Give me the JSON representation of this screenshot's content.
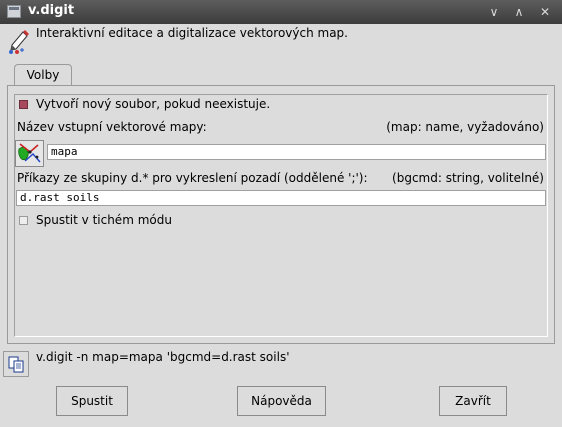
{
  "window": {
    "title": "v.digit"
  },
  "header": {
    "description": "Interaktivní editace a digitalizace vektorových map."
  },
  "tabs": [
    {
      "label": "Volby"
    }
  ],
  "options": {
    "create_new": {
      "label": "Vytvoří nový soubor, pokud neexistuje.",
      "checked": true
    },
    "map": {
      "label": "Název vstupní vektorové mapy:",
      "hint": "(map:  name, vyžadováno)",
      "value": "mapa"
    },
    "bgcmd": {
      "label": "Příkazy ze skupiny d.* pro vykreslení pozadí (oddělené ';'):",
      "hint": "(bgcmd:  string, volitelné)",
      "value": "d.rast soils"
    },
    "quiet": {
      "label": "Spustit v tichém módu",
      "checked": false
    }
  },
  "command_line": "v.digit -n map=mapa 'bgcmd=d.rast soils'",
  "buttons": {
    "run": "Spustit",
    "help": "Nápověda",
    "close": "Zavřít"
  },
  "colors": {
    "titlebar": "#4a4a4a",
    "checked": "#a8485d",
    "background": "#dcdcdc"
  }
}
